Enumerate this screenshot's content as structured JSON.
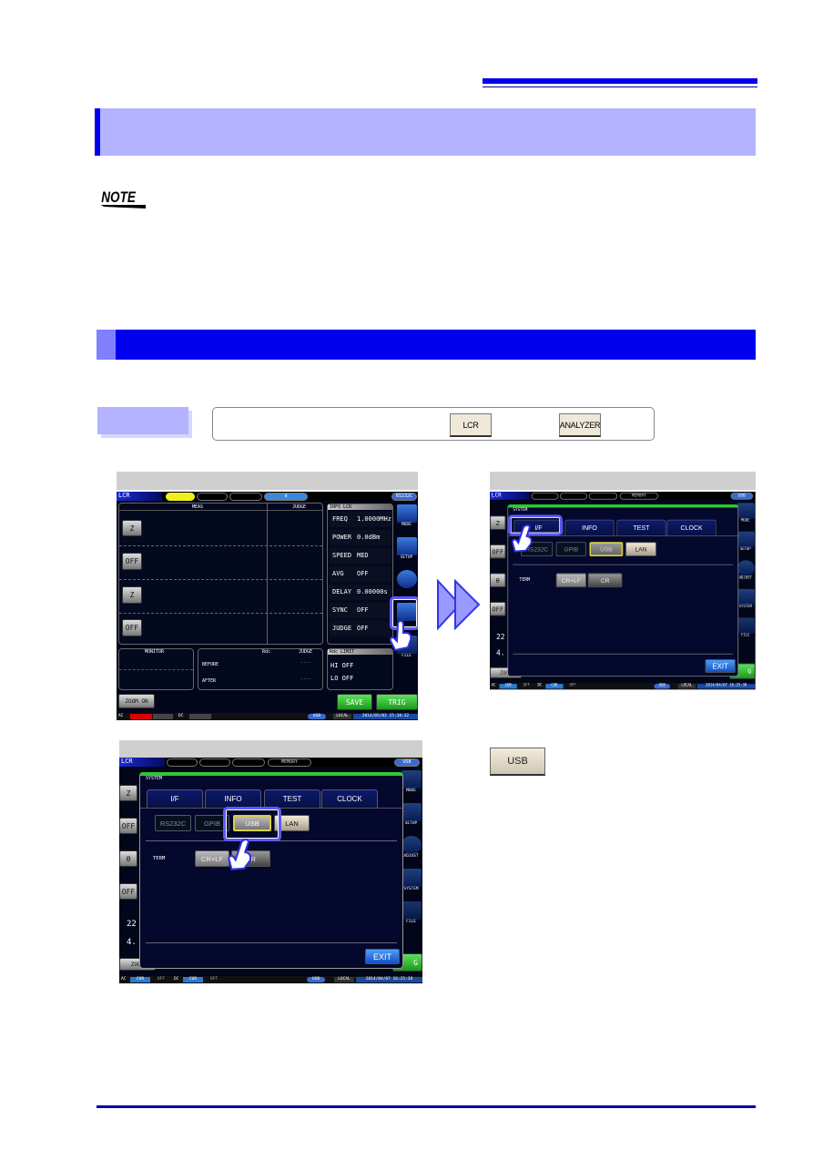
{
  "colors": {
    "accent": "#0000ee",
    "title_bg": "#b3b3ff",
    "highlight": "#5a5aff"
  },
  "note_logo": "NOTE",
  "procedure": {
    "buttons": [
      "LCR",
      "ANALYZER"
    ]
  },
  "screen1": {
    "mode": "LCR",
    "tab_d": "d",
    "interface": "RS232C",
    "meas_header": "MEAS",
    "judge_header": "JUDGE",
    "param_buttons": [
      "Z",
      "OFF",
      "Z",
      "OFF"
    ],
    "info_header": "INFO LCR",
    "info": [
      {
        "k": "FREQ",
        "v": "1.0000MHz"
      },
      {
        "k": "POWER",
        "v": "0.0dBm"
      },
      {
        "k": "SPEED",
        "v": "MED"
      },
      {
        "k": "AVG",
        "v": "OFF"
      },
      {
        "k": "DELAY",
        "v": "0.00000s"
      },
      {
        "k": "SYNC",
        "v": "OFF"
      },
      {
        "k": "JUDGE",
        "v": "OFF"
      }
    ],
    "side_icons": [
      "MODE",
      "SETUP",
      "ADJUST",
      "SYSTEM",
      "FILE"
    ],
    "monitor": "MONITOR",
    "rdc": "Rdc",
    "rdc_judge": "JUDGE",
    "before": "BEFORE",
    "after": "AFTER",
    "dash": "----",
    "rdc_limit": "Rdc LIMIT",
    "hi": "HI  OFF",
    "lo": "LO  OFF",
    "zoom": "ZOOM ON",
    "save": "SAVE",
    "trig": "TRIG",
    "status": {
      "ac": "AC",
      "dc": "DC",
      "usb": "USB",
      "local": "LOCAL",
      "datetime": "2014/05/02 15:38:32"
    }
  },
  "system_screen": {
    "mode": "LCR",
    "memory": "MEMORY",
    "interface": "USB",
    "dialog_title": "SYSTEM",
    "tabs": [
      "I/F",
      "INFO",
      "TEST",
      "CLOCK"
    ],
    "if_buttons": [
      "RS232C",
      "GPIB",
      "USB",
      "LAN"
    ],
    "term_label": "TERM",
    "term_buttons": [
      "CR+LF",
      "CR"
    ],
    "exit": "EXIT",
    "bg_left": [
      "Z",
      "OFF",
      "θ",
      "OFF",
      "22",
      "4.",
      "ZOOM"
    ],
    "side_icons": [
      "MODE",
      "SETUP",
      "ADJUST",
      "SYSTEM",
      "FILE"
    ],
    "trig_partial": "G",
    "status": {
      "ac": "AC",
      "cur": "CUR",
      "off": "OFF",
      "dc": "DC",
      "usb": "USB",
      "local": "LOCAL",
      "datetime": "2014/04/07 16:25:38"
    }
  },
  "usb_key": "USB"
}
